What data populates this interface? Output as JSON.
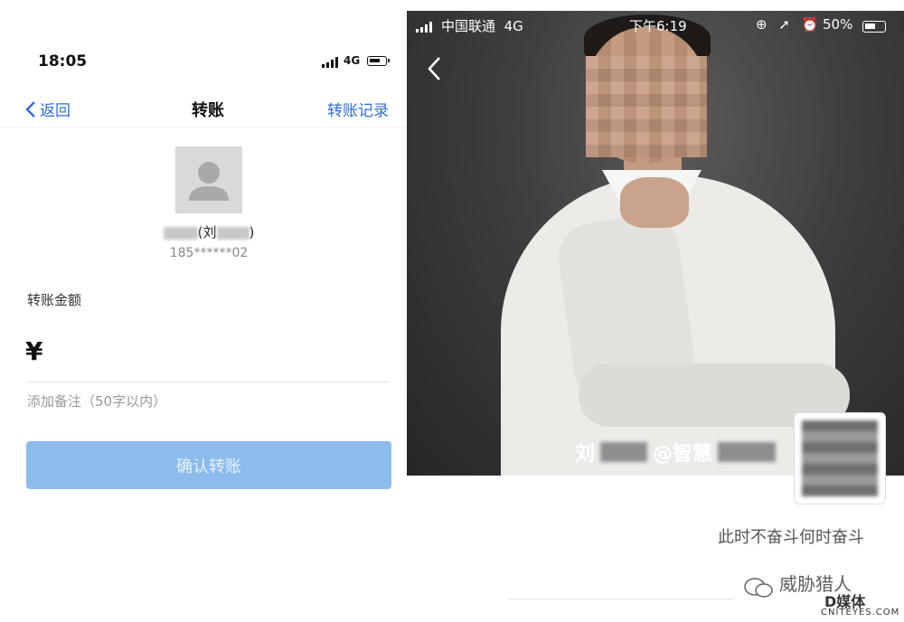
{
  "left": {
    "status": {
      "time": "18:05",
      "network": "4G"
    },
    "nav": {
      "back_label": "返回",
      "title": "转账",
      "history_label": "转账记录"
    },
    "recipient": {
      "name_open": "(刘",
      "name_close": ")",
      "phone": "185******02"
    },
    "amount": {
      "label": "转账金额",
      "currency": "¥",
      "value": ""
    },
    "note": {
      "placeholder": "添加备注（50字以内）"
    },
    "confirm_label": "确认转账",
    "colors": {
      "accent": "#2f6ed6",
      "confirm_bg": "#8cbcec"
    }
  },
  "right": {
    "status": {
      "carrier": "中国联通",
      "network": "4G",
      "time": "下午6:19",
      "icons": "⊕ ➚ ⏰",
      "battery": "50%"
    },
    "caption": {
      "prefix": "刘",
      "middle": "@智慧"
    },
    "slogan": "此时不奋斗何时奋斗",
    "watermark": {
      "line1": "威胁猎人",
      "line2": "D媒体",
      "line3": "CNITEYES.COM"
    }
  }
}
